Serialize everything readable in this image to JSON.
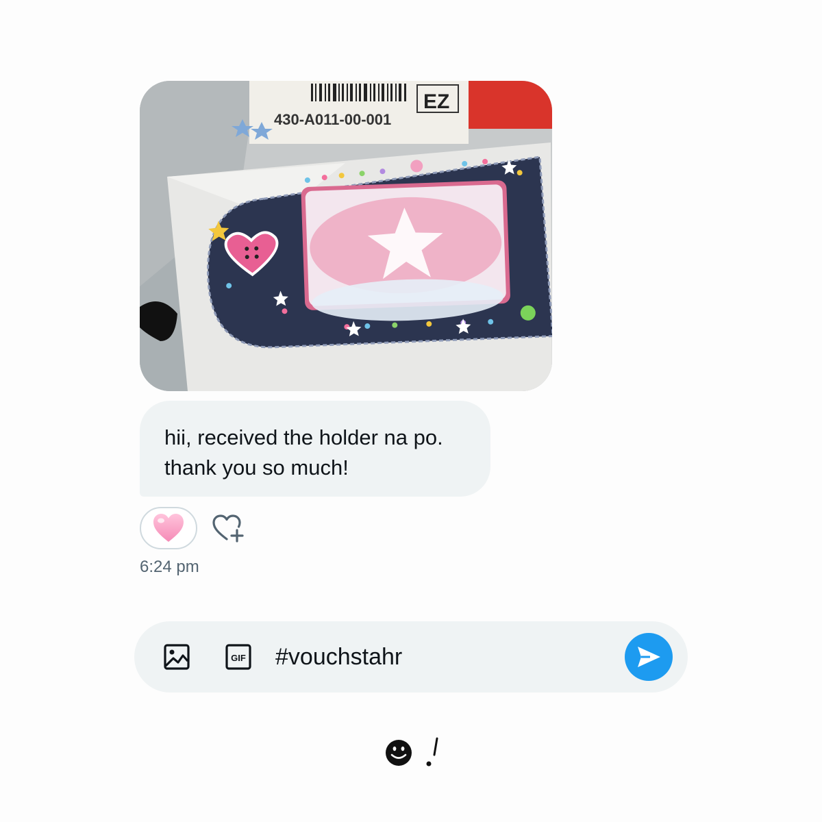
{
  "photo": {
    "label_code": "EZ",
    "label_number": "430-A011-00-001",
    "subject": "photocard-holder"
  },
  "message": {
    "lines": [
      "hii, received the holder na po.",
      "thank you so much!"
    ]
  },
  "reaction": {
    "emoji": "heart",
    "color": "#f7a3c8"
  },
  "timestamp": "6:24 pm",
  "composer": {
    "value": "#vouchstahr",
    "media_icon": "image-icon",
    "gif_icon": "gif-icon",
    "gif_label": "GIF",
    "send_icon": "send-icon",
    "accent": "#1d9bf0"
  },
  "signature": {
    "icon": "smiley-icon",
    "mark": "./"
  }
}
